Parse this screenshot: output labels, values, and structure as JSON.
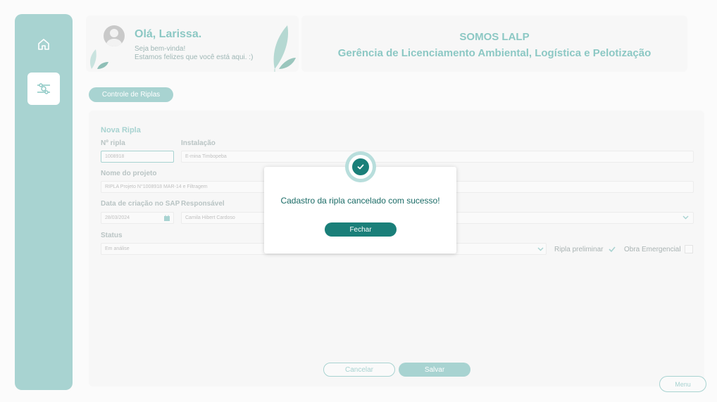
{
  "greeting": {
    "title": "Olá, Larissa.",
    "line1": "Seja bem-vinda!",
    "line2": "Estamos felizes que você está aqui. :)"
  },
  "banner": {
    "line1": "SOMOS LALP",
    "line2": "Gerência de Licenciamento Ambiental, Logística e Pelotização"
  },
  "tab": {
    "label": "Controle de Riplas"
  },
  "form": {
    "section_title": "Nova Ripla",
    "labels": {
      "ripla_no": "Nº ripla",
      "instalacao": "Instalação",
      "nome_projeto": "Nome do projeto",
      "data_sap": "Data de criação no SAP",
      "responsavel": "Responsável",
      "status": "Status",
      "ripla_preliminar": "Ripla preliminar",
      "obra_emergencial": "Obra Emergencial"
    },
    "values": {
      "ripla_no": "1008918",
      "instalacao": "E-mina Timbopeba",
      "nome_projeto": "RIPLA Projeto N°1008918 MAR-14 e Filtragem",
      "data_sap": "28/03/2024",
      "responsavel": "Camila Hibert Cardoso",
      "status": "Em análise"
    },
    "checks": {
      "ripla_preliminar": true,
      "obra_emergencial": false
    },
    "buttons": {
      "cancel": "Cancelar",
      "save": "Salvar"
    }
  },
  "menu_button": "Menu",
  "modal": {
    "message": "Cadastro da ripla cancelado com sucesso!",
    "button": "Fechar"
  },
  "colors": {
    "accent": "#a8d3d1",
    "primary_dark": "#1a7f79"
  },
  "icons": [
    "home-icon",
    "settings-icon",
    "calendar-icon",
    "chevron-down-icon",
    "check-icon",
    "leaf-icon"
  ]
}
